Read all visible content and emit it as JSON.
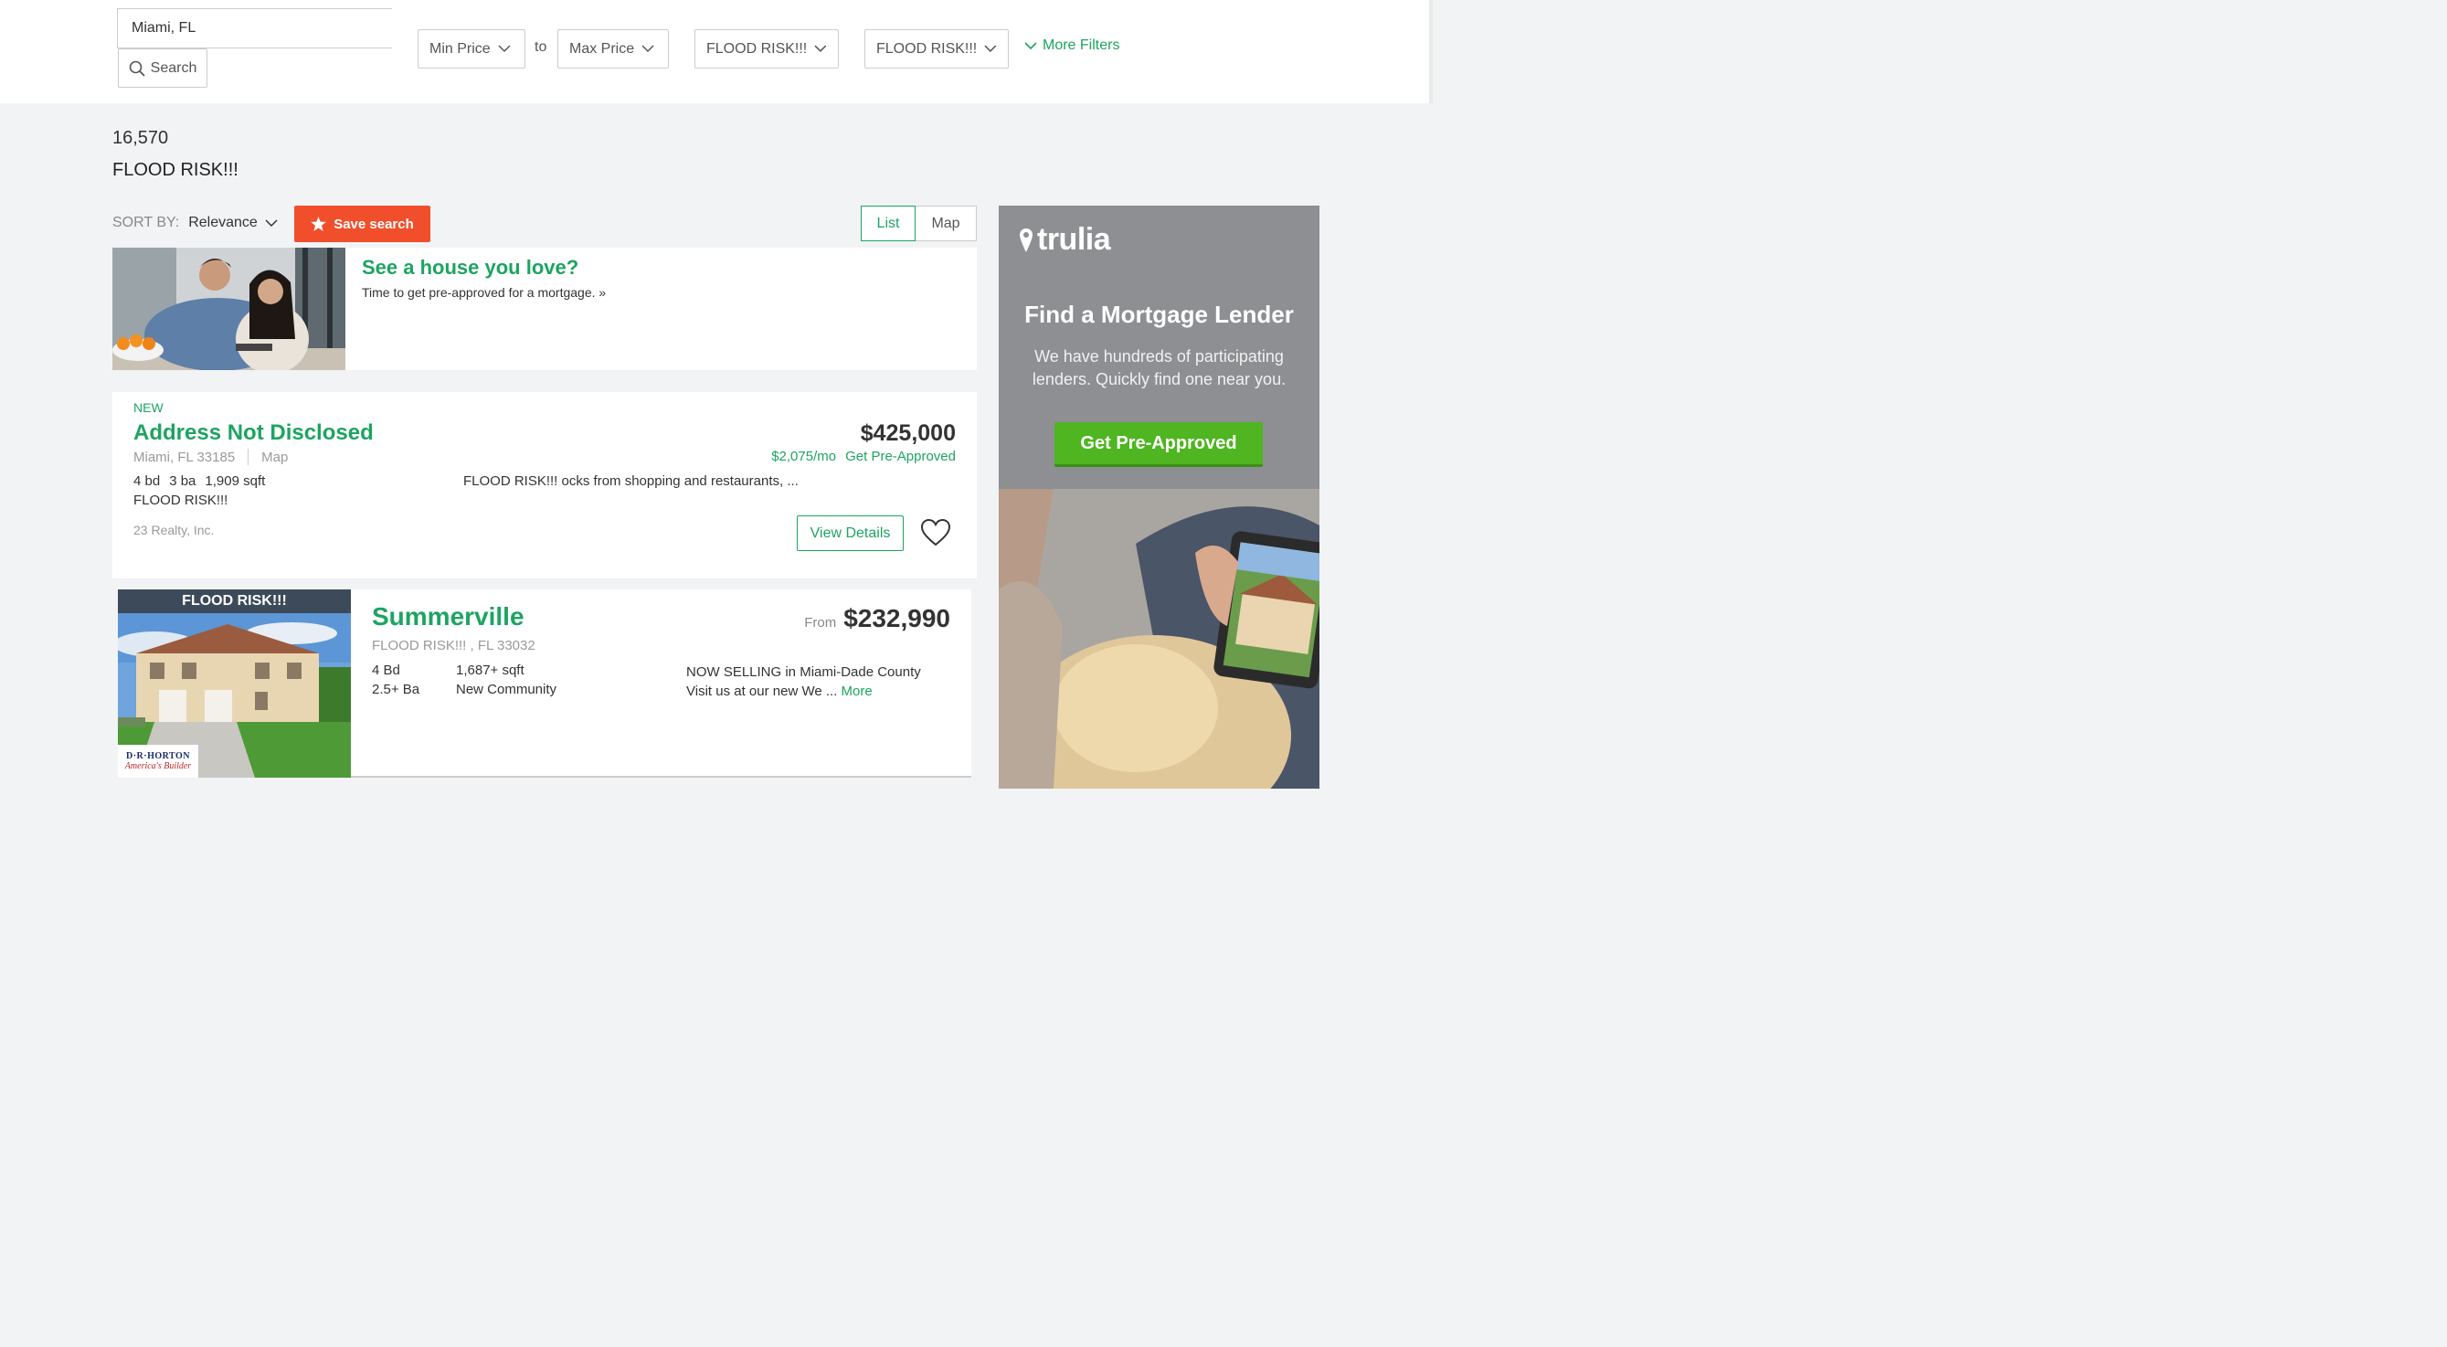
{
  "search": {
    "location_value": "Miami, FL",
    "button_label": "Search"
  },
  "filters": {
    "min_price": "Min Price",
    "to_label": "to",
    "max_price": "Max Price",
    "filter_3": "FLOOD RISK!!!",
    "filter_4": "FLOOD RISK!!!",
    "more_filters": "More Filters"
  },
  "results": {
    "count": "16,570",
    "heading": "FLOOD RISK!!!"
  },
  "toolbar": {
    "sort_by_label": "SORT BY:",
    "sort_value": "Relevance",
    "save_search": "Save search",
    "view_list": "List",
    "view_map": "Map"
  },
  "promo": {
    "title": "See a house you love?",
    "subtitle": "Time to get pre-approved for a mortgage. »"
  },
  "listings": [
    {
      "badge": "NEW",
      "title": "Address Not Disclosed",
      "location": "Miami, FL 33185",
      "map_link": "Map",
      "beds": "4 bd",
      "baths": "3 ba",
      "sqft": "1,909 sqft",
      "tag": "FLOOD RISK!!!",
      "description": "FLOOD RISK!!! ocks from shopping and restaurants, ...",
      "broker": "23 Realty, Inc.",
      "price": "$425,000",
      "monthly": "$2,075/mo",
      "preapproved_link": "Get Pre-Approved",
      "view_details": "View Details"
    },
    {
      "image_banner": "FLOOD RISK!!!",
      "builder_logo_line1": "D·R·HORTON",
      "builder_logo_line2": "America's Builder",
      "title": "Summerville",
      "location": "FLOOD RISK!!! , FL 33032",
      "beds": "4 Bd",
      "sqft": "1,687+ sqft",
      "baths": "2.5+ Ba",
      "type": "New Community",
      "description_line1": "NOW SELLING in Miami-Dade County",
      "description_line2": "Visit us at our new We ...",
      "more_link": "More",
      "price_prefix": "From",
      "price": "$232,990"
    }
  ],
  "ad": {
    "brand": "trulia",
    "title": "Find a Mortgage Lender",
    "subtitle": "We have hundreds of participating lenders. Quickly find one near you.",
    "button": "Get Pre-Approved"
  },
  "colors": {
    "accent_green": "#1da461",
    "save_orange": "#f14f2c",
    "ad_button_green": "#4fb520",
    "ad_background": "#8d8f93"
  }
}
